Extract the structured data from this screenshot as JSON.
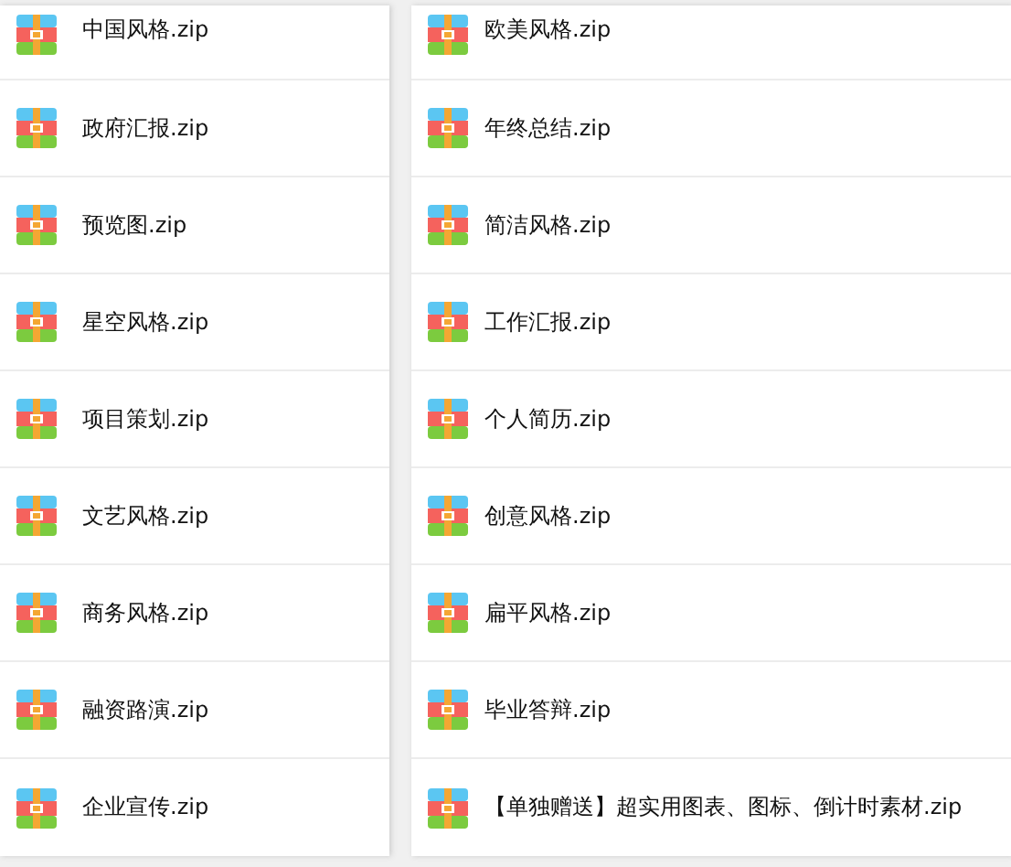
{
  "columns": [
    {
      "files": [
        {
          "name": "中国风格.zip"
        },
        {
          "name": "政府汇报.zip"
        },
        {
          "name": "预览图.zip"
        },
        {
          "name": "星空风格.zip"
        },
        {
          "name": "项目策划.zip"
        },
        {
          "name": "文艺风格.zip"
        },
        {
          "name": "商务风格.zip"
        },
        {
          "name": "融资路演.zip"
        },
        {
          "name": "企业宣传.zip"
        }
      ]
    },
    {
      "files": [
        {
          "name": "欧美风格.zip"
        },
        {
          "name": "年终总结.zip"
        },
        {
          "name": "简洁风格.zip"
        },
        {
          "name": "工作汇报.zip"
        },
        {
          "name": "个人简历.zip"
        },
        {
          "name": "创意风格.zip"
        },
        {
          "name": "扁平风格.zip"
        },
        {
          "name": "毕业答辩.zip"
        },
        {
          "name": "【单独赠送】超实用图表、图标、倒计时素材.zip"
        }
      ]
    }
  ]
}
